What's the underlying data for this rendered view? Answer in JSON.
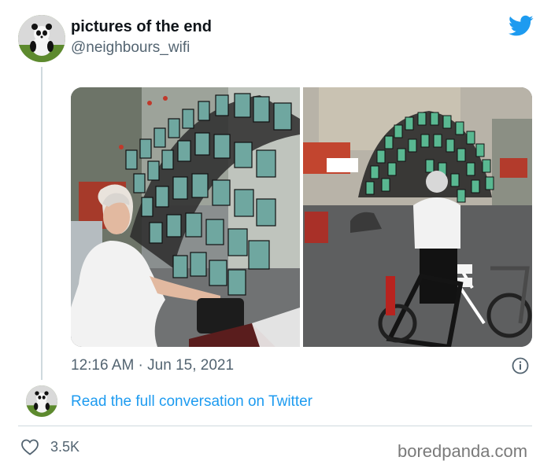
{
  "tweet": {
    "display_name": "pictures of the end",
    "handle": "@neighbours_wifi",
    "timestamp": "12:16 AM · Jun 15, 2021",
    "read_more": "Read the full conversation on Twitter",
    "likes": "3.5K"
  },
  "icons": {
    "brand": "twitter-bird-icon",
    "info": "info-icon",
    "like": "heart-icon"
  },
  "colors": {
    "twitter_blue": "#1d9bf0",
    "secondary_text": "#536471",
    "divider": "#cfd9de"
  },
  "watermark": "boredpanda.com"
}
